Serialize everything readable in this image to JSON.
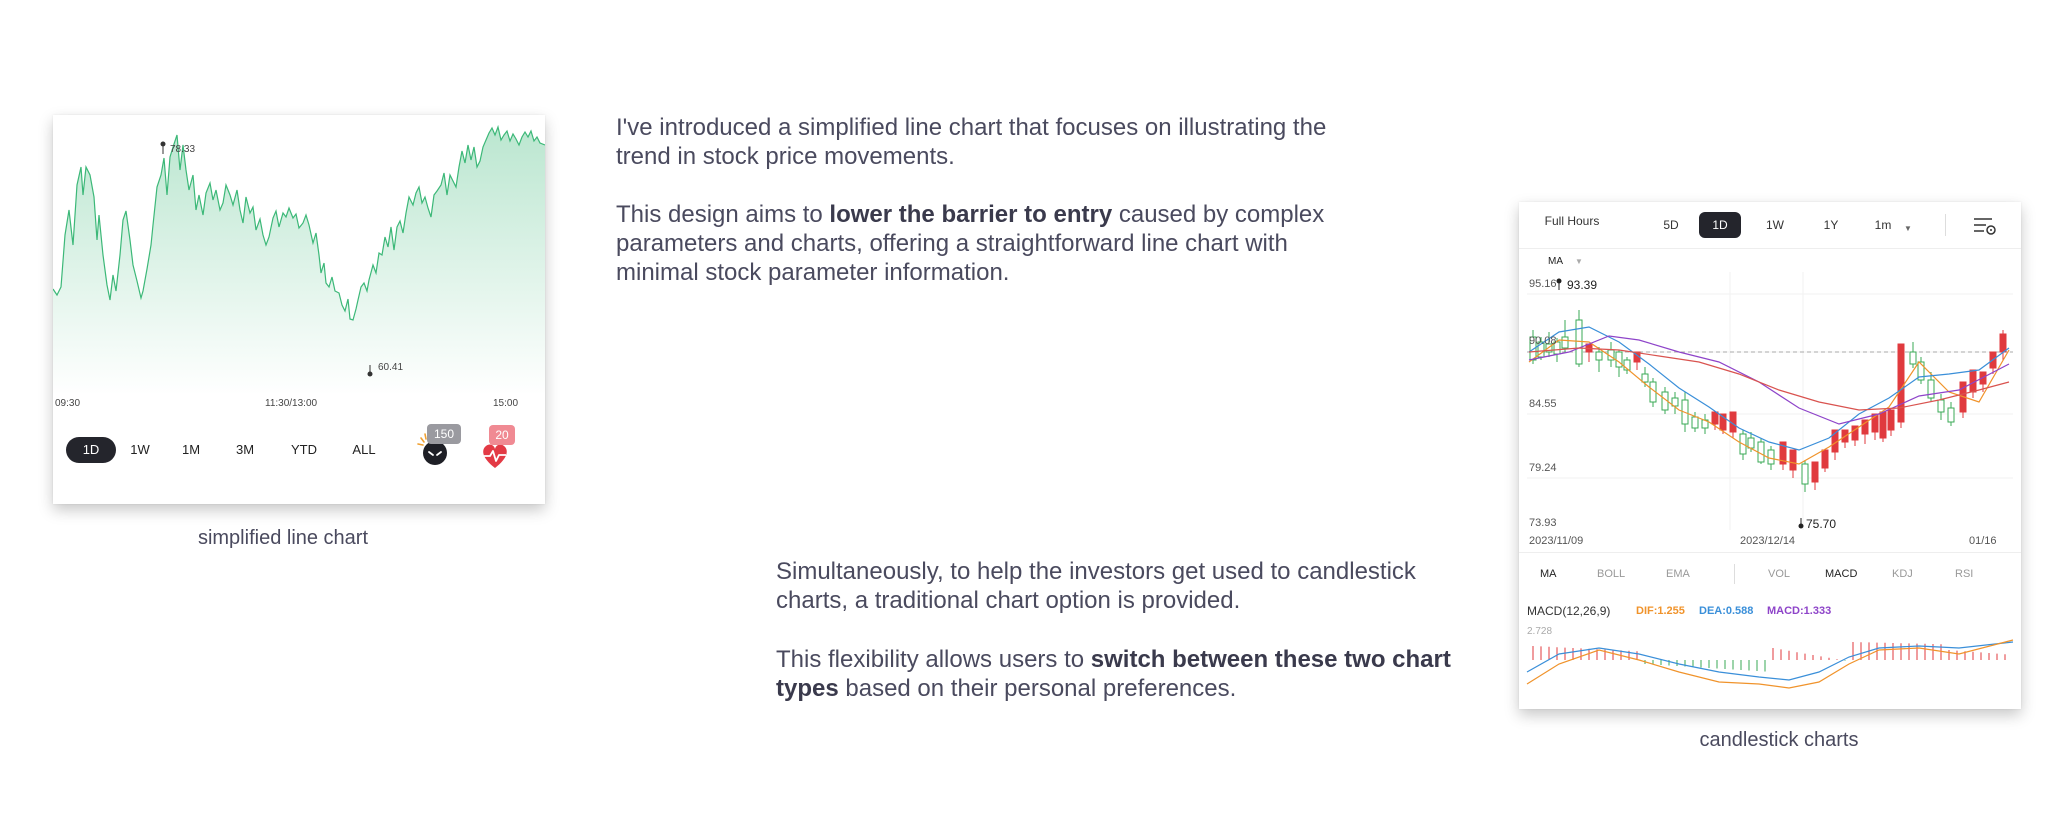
{
  "simple_chart": {
    "max_label": "78.33",
    "min_label": "60.41",
    "x_ticks": [
      "09:30",
      "11:30/13:00",
      "15:00"
    ],
    "ranges": [
      "1D",
      "1W",
      "1M",
      "3M",
      "YTD",
      "ALL"
    ],
    "active_range": "1D",
    "badge_left": "150",
    "badge_right": "20",
    "line_color": "#3cb878",
    "caption": "simplified line chart"
  },
  "text_top": {
    "p1": "I've introduced a simplified line chart that focuses on illustrating the trend in stock price movements.",
    "p2_before": "This design aims to ",
    "p2_bold": "lower the barrier to entry",
    "p2_after": " caused by complex parameters and charts, offering a straightforward line chart with minimal stock parameter information."
  },
  "text_bottom": {
    "p1": "Simultaneously, to help the investors get used to candlestick charts, a traditional chart option is provided.",
    "p2_before": "This flexibility allows users to ",
    "p2_bold": "switch between these two chart types",
    "p2_after": " based on their personal preferences."
  },
  "candle_chart": {
    "tabs": [
      "Full Hours",
      "5D",
      "1D",
      "1W",
      "1Y",
      "1m"
    ],
    "active_tab": "1D",
    "ma_label": "MA",
    "y_ticks": [
      "95.16",
      "90.08",
      "84.55",
      "79.24",
      "73.93"
    ],
    "high_label": "93.39",
    "low_label": "75.70",
    "x_ticks": [
      "2023/11/09",
      "2023/12/14",
      "01/16"
    ],
    "indicators_left": [
      "MA",
      "BOLL",
      "EMA"
    ],
    "indicators_right": [
      "VOL",
      "MACD",
      "KDJ",
      "RSI"
    ],
    "macd_title": "MACD(12,26,9)",
    "dif": "DIF:1.255",
    "dea": "DEA:0.588",
    "macd": "MACD:1.333",
    "macd_axis": "2.728",
    "up_color": "#e03a3e",
    "down_color": "#3aaa55",
    "caption": "candlestick charts"
  }
}
